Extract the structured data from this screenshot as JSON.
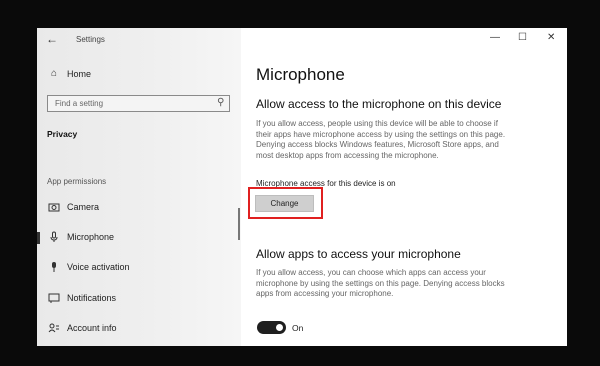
{
  "window": {
    "title": "Settings"
  },
  "sidebar": {
    "home": "Home",
    "search_placeholder": "Find a setting",
    "section": "Privacy",
    "group": "App permissions",
    "items": [
      {
        "label": "Camera",
        "icon": "camera-icon"
      },
      {
        "label": "Microphone",
        "icon": "microphone-icon",
        "selected": true
      },
      {
        "label": "Voice activation",
        "icon": "voice-activation-icon"
      },
      {
        "label": "Notifications",
        "icon": "notifications-icon"
      },
      {
        "label": "Account info",
        "icon": "account-info-icon"
      }
    ]
  },
  "main": {
    "title": "Microphone",
    "device_section": {
      "heading": "Allow access to the microphone on this device",
      "lines": [
        "If you allow access, people using this device will be able to choose if",
        "their apps have microphone access by using the settings on this page.",
        "Denying access blocks Windows features, Microsoft Store apps, and",
        "most desktop apps from accessing the microphone."
      ],
      "status": "Microphone access for this device is on",
      "button": "Change"
    },
    "apps_section": {
      "heading": "Allow apps to access your microphone",
      "lines": [
        "If you allow access, you can choose which apps can access your",
        "microphone by using the settings on this page. Denying access blocks",
        "apps from accessing your microphone."
      ],
      "toggle_label": "On",
      "toggle_on": true
    }
  },
  "colors": {
    "highlight": "#e02020",
    "toggle_on": "#1f1f1f"
  }
}
